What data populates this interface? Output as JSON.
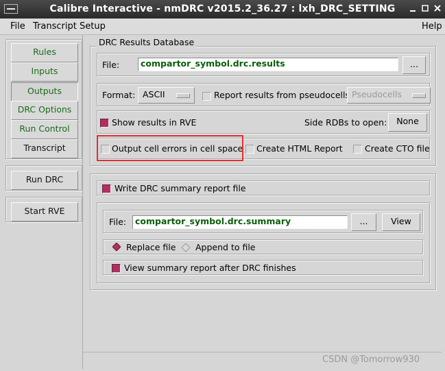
{
  "window": {
    "title": "Calibre Interactive - nmDRC v2015.2_36.27 : lxh_DRC_SETTING"
  },
  "menubar": {
    "file": "File",
    "transcript": "Transcript",
    "setup": "Setup",
    "help": "Help"
  },
  "nav": {
    "rules": "Rules",
    "inputs": "Inputs",
    "outputs": "Outputs",
    "drc_options": "DRC Options",
    "run_control": "Run Control",
    "transcript": "Transcript",
    "run_drc": "Run DRC",
    "start_rve": "Start RVE"
  },
  "results_db": {
    "group_title": "DRC Results Database",
    "file_label": "File:",
    "file_value": "compartor_symbol.drc.results",
    "browse_label": "...",
    "format_label": "Format:",
    "format_value": "ASCII",
    "pseudocells_label": "Report results from pseudocells in:",
    "pseudocells_value": "Pseudocells",
    "show_rve_label": "Show results in RVE",
    "show_rve_checked": true,
    "side_rdbs_label": "Side RDBs to open:",
    "side_rdbs_value": "None",
    "output_cell_errors_label": "Output cell errors in cell space",
    "output_cell_errors_checked": false,
    "html_report_label": "Create HTML Report",
    "html_report_checked": false,
    "cto_label": "Create CTO file",
    "cto_checked": false
  },
  "summary": {
    "write_label": "Write DRC summary report file",
    "write_checked": true,
    "file_label": "File:",
    "file_value": "compartor_symbol.drc.summary",
    "browse_label": "...",
    "view_label": "View",
    "replace_label": "Replace file",
    "append_label": "Append to file",
    "mode": "replace",
    "view_after_label": "View summary report after DRC finishes",
    "view_after_checked": true
  },
  "watermark": "CSDN @Tomorrow930",
  "colors": {
    "accent": "#b03060",
    "highlight_box": "#e03030",
    "field_text": "#0a5d0a"
  }
}
